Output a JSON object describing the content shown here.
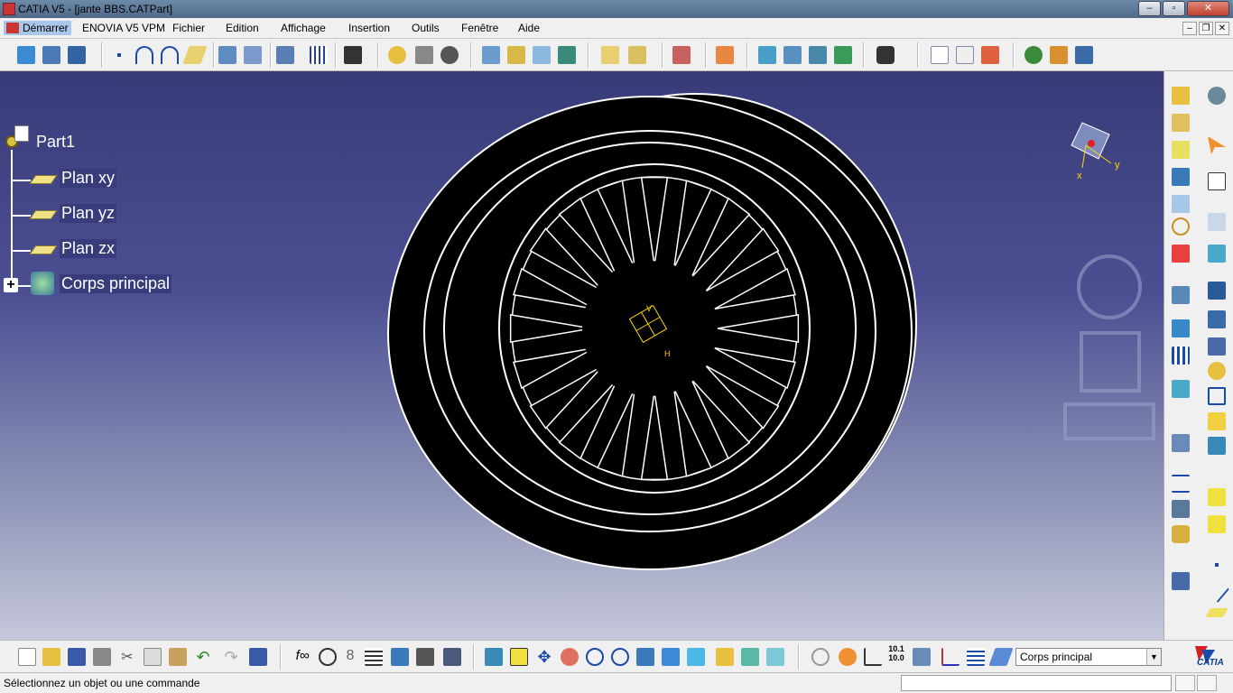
{
  "window": {
    "title": "CATIA V5 - [jante BBS.CATPart]"
  },
  "menubar": {
    "items": [
      "Démarrer",
      "ENOVIA V5 VPM",
      "Fichier",
      "Edition",
      "Affichage",
      "Insertion",
      "Outils",
      "Fenêtre",
      "Aide"
    ]
  },
  "tree": {
    "root": "Part1",
    "items": [
      "Plan xy",
      "Plan yz",
      "Plan zx",
      "Corps principal"
    ]
  },
  "compass": {
    "axis_x": "x",
    "axis_y": "y"
  },
  "origin": {
    "v": "V",
    "h": "H"
  },
  "bottom": {
    "current_body": "Corps principal"
  },
  "status": {
    "message": "Sélectionnez un objet ou une commande"
  },
  "logo": {
    "text": "CATIA"
  },
  "colors": {
    "viewport_top": "#383b78",
    "viewport_bottom": "#c6c9db",
    "accent": "#a9c7ea"
  }
}
